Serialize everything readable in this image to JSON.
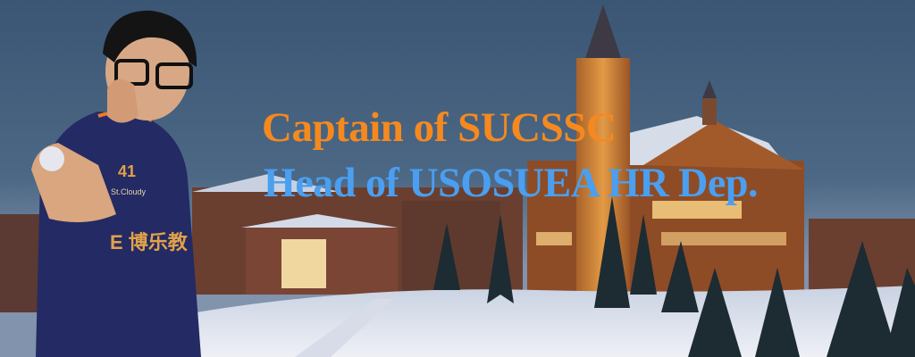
{
  "banner": {
    "line1": "Captain of SUCSSC",
    "line2": "Head of USOSUEA HR Dep.",
    "line1_color": "#f5891f",
    "line2_color": "#4a9ff0"
  },
  "jersey": {
    "number": "41",
    "name": "St.Cloudy",
    "sponsor": "E 博乐教"
  }
}
